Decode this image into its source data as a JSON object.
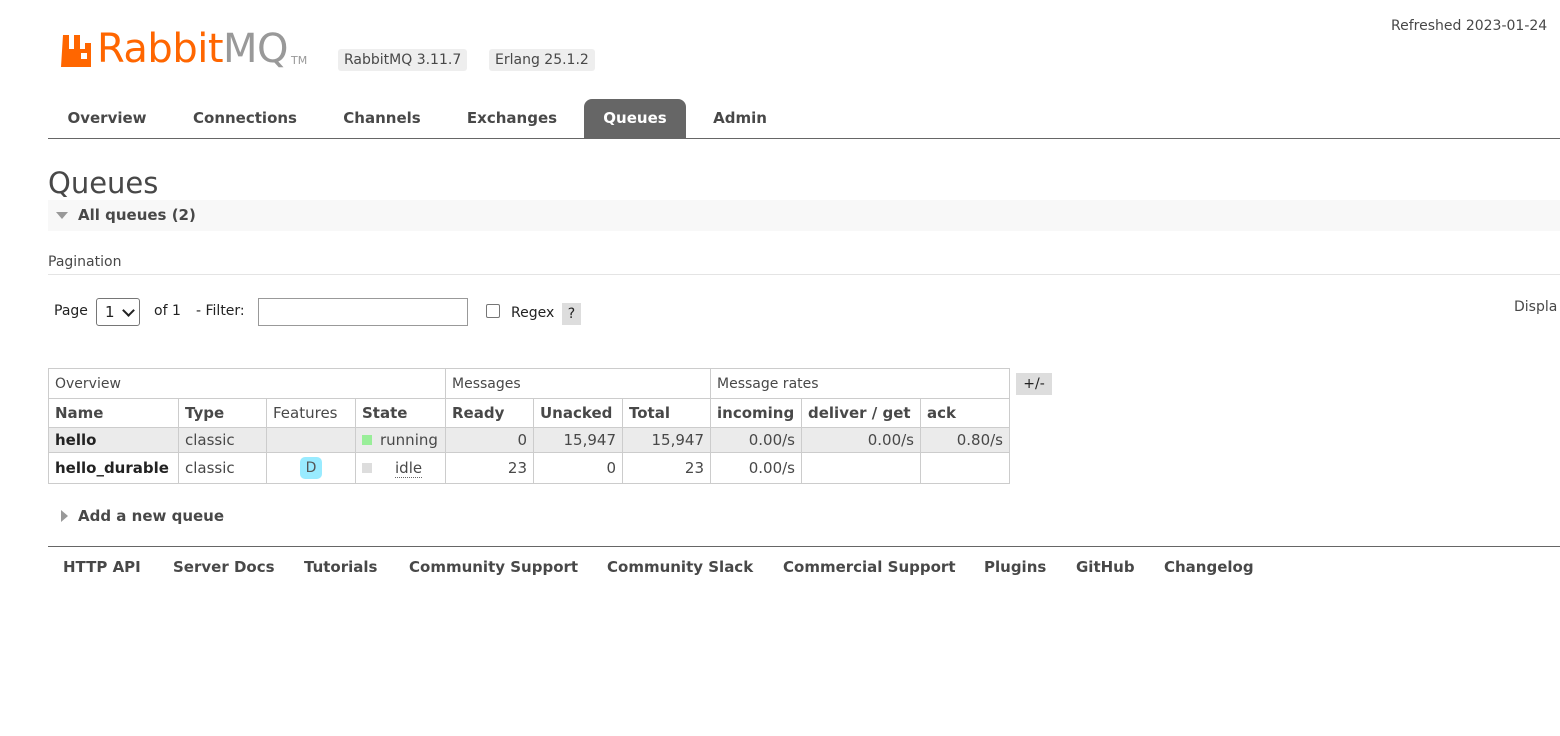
{
  "header": {
    "logo_text_a": "Rabbit",
    "logo_text_b": "MQ",
    "logo_tm": "TM",
    "version_rabbitmq": "RabbitMQ 3.11.7",
    "version_erlang": "Erlang 25.1.2",
    "refreshed": "Refreshed 2023-01-24",
    "brand_color": "#ff6600"
  },
  "tabs": [
    {
      "label": "Overview",
      "active": false
    },
    {
      "label": "Connections",
      "active": false
    },
    {
      "label": "Channels",
      "active": false
    },
    {
      "label": "Exchanges",
      "active": false
    },
    {
      "label": "Queues",
      "active": true
    },
    {
      "label": "Admin",
      "active": false
    }
  ],
  "main": {
    "title": "Queues",
    "section_toggle": "All queues (2)",
    "pagination_label": "Pagination",
    "page_label": "Page",
    "page_value": "1",
    "of_label": "of 1",
    "filter_label": "- Filter:",
    "filter_value": "",
    "regex_label": "Regex",
    "regex_checked": false,
    "help_label": "?",
    "display_label": "Displa",
    "columns_toggle": "+/-",
    "add_queue": "Add a new queue"
  },
  "table": {
    "groups": [
      "Overview",
      "Messages",
      "Message rates"
    ],
    "columns": [
      "Name",
      "Type",
      "Features",
      "State",
      "Ready",
      "Unacked",
      "Total",
      "incoming",
      "deliver / get",
      "ack"
    ],
    "rows": [
      {
        "name": "hello",
        "type": "classic",
        "features": "",
        "state": "running",
        "state_color": "#99ee99",
        "ready": "0",
        "unacked": "15,947",
        "total": "15,947",
        "incoming": "0.00/s",
        "deliver_get": "0.00/s",
        "ack": "0.80/s"
      },
      {
        "name": "hello_durable",
        "type": "classic",
        "features": "D",
        "state": "idle",
        "state_color": "#dddddd",
        "ready": "23",
        "unacked": "0",
        "total": "23",
        "incoming": "0.00/s",
        "deliver_get": "",
        "ack": ""
      }
    ]
  },
  "footer": {
    "links": [
      "HTTP API",
      "Server Docs",
      "Tutorials",
      "Community Support",
      "Community Slack",
      "Commercial Support",
      "Plugins",
      "GitHub",
      "Changelog"
    ]
  }
}
